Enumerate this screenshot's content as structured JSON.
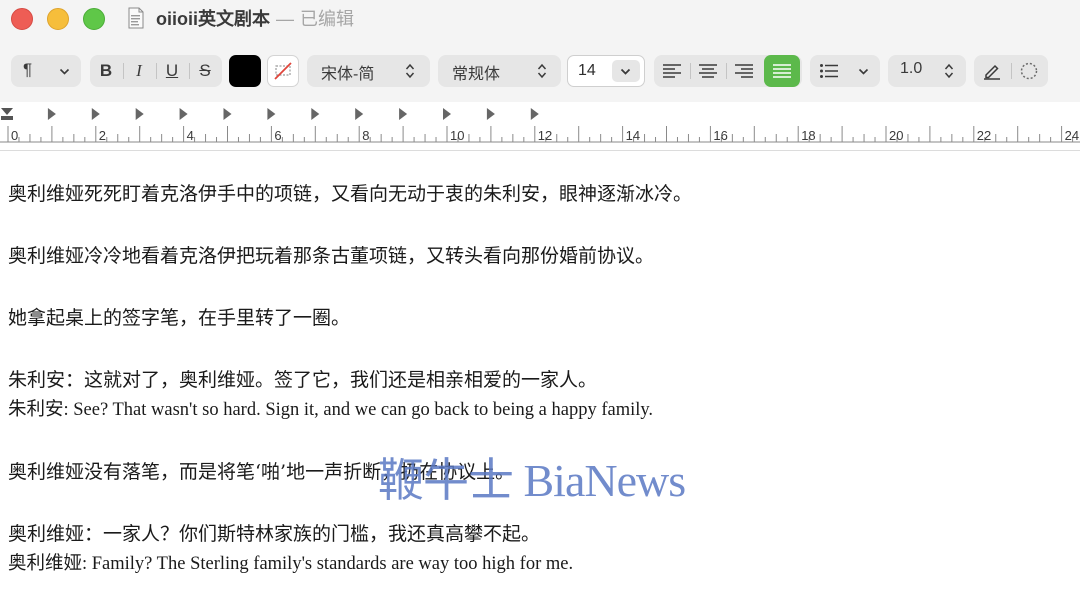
{
  "window": {
    "title": "oiioii英文剧本",
    "separator": "—",
    "status": "已编辑"
  },
  "toolbar": {
    "paragraph_style_icon": "¶",
    "bold": "B",
    "italic": "I",
    "underline": "U",
    "strikethrough": "S",
    "text_color": "#000000",
    "font_family": "宋体-简",
    "font_style": "常规体",
    "font_size": "14",
    "alignment_selected": "justify",
    "line_spacing": "1.0",
    "accent_color": "#5cb94b"
  },
  "ruler": {
    "labels": [
      "0",
      "2",
      "4",
      "6",
      "8",
      "10",
      "12",
      "14",
      "16",
      "18",
      "20",
      "22",
      "24"
    ]
  },
  "document": {
    "paragraphs": [
      "奥利维娅死死盯着克洛伊手中的项链，又看向无动于衷的朱利安，眼神逐渐冰冷。",
      "奥利维娅冷冷地看着克洛伊把玩着那条古董项链，又转头看向那份婚前协议。",
      "她拿起桌上的签字笔，在手里转了一圈。",
      "朱利安：这就对了，奥利维娅。签了它，我们还是相亲相爱的一家人。",
      "朱利安: See? That wasn't so hard. Sign it, and we can go back to being a happy family.",
      "奥利维娅没有落笔，而是将笔‘啪’地一声折断，扔在协议上。",
      "奥利维娅：一家人？你们斯特林家族的门槛，我还真高攀不起。",
      "奥利维娅: Family? The Sterling family's standards are way too high for me."
    ]
  },
  "watermark": "鞭牛士 BiaNews"
}
